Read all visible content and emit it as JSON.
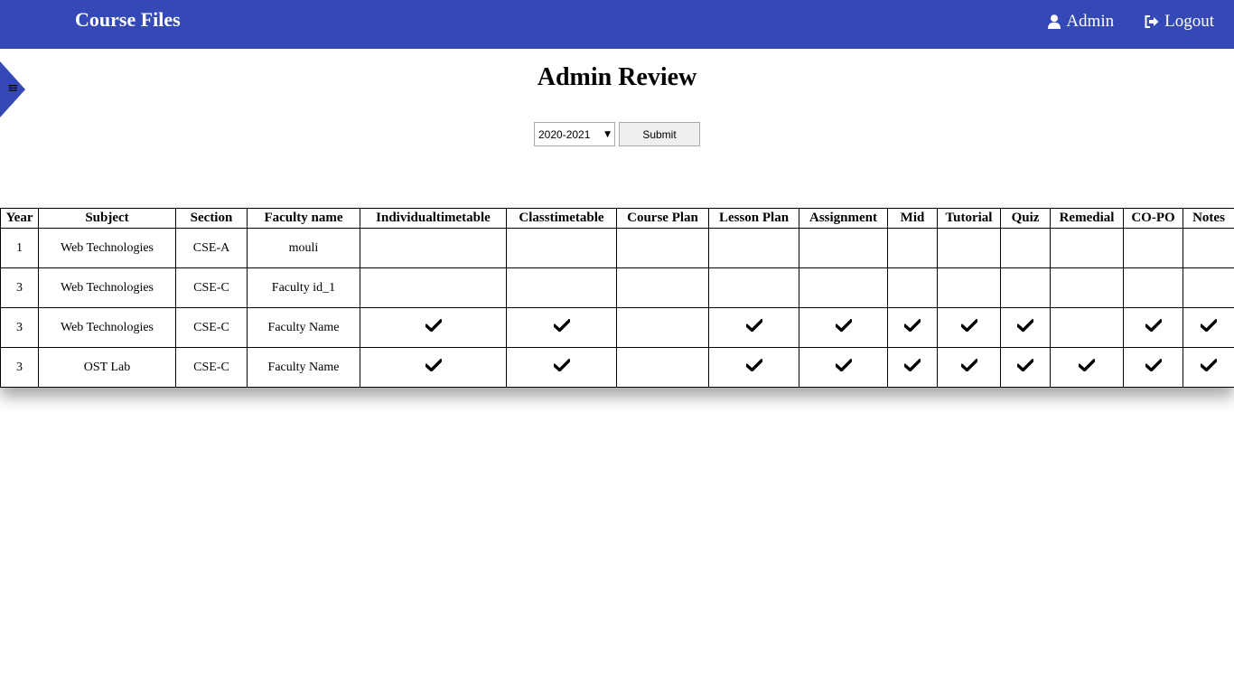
{
  "navbar": {
    "brand": "Course Files",
    "user_label": "Admin",
    "logout_label": "Logout",
    "bg_color": "#3448b6"
  },
  "sidebar_toggle": {
    "icon": "menu-icon",
    "glyph": "≡"
  },
  "page": {
    "title": "Admin Review"
  },
  "filter": {
    "selected_year": "2020-2021",
    "submit_label": "Submit"
  },
  "table": {
    "columns": [
      "Year",
      "Subject",
      "Section",
      "Faculty name",
      "Individualtimetable",
      "Classtimetable",
      "Course Plan",
      "Lesson Plan",
      "Assignment",
      "Mid",
      "Tutorial",
      "Quiz",
      "Remedial",
      "CO-PO",
      "Notes"
    ],
    "rows": [
      {
        "year": "1",
        "subject": "Web Technologies",
        "section": "CSE-A",
        "faculty": "mouli",
        "checks": [
          false,
          false,
          false,
          false,
          false,
          false,
          false,
          false,
          false,
          false,
          false
        ]
      },
      {
        "year": "3",
        "subject": "Web Technologies",
        "section": "CSE-C",
        "faculty": "Faculty id_1",
        "checks": [
          false,
          false,
          false,
          false,
          false,
          false,
          false,
          false,
          false,
          false,
          false
        ]
      },
      {
        "year": "3",
        "subject": "Web Technologies",
        "section": "CSE-C",
        "faculty": "Faculty Name",
        "checks": [
          true,
          true,
          false,
          true,
          true,
          true,
          true,
          true,
          false,
          true,
          true
        ]
      },
      {
        "year": "3",
        "subject": "OST Lab",
        "section": "CSE-C",
        "faculty": "Faculty Name",
        "checks": [
          true,
          true,
          false,
          true,
          true,
          true,
          true,
          true,
          true,
          true,
          true
        ]
      }
    ]
  }
}
